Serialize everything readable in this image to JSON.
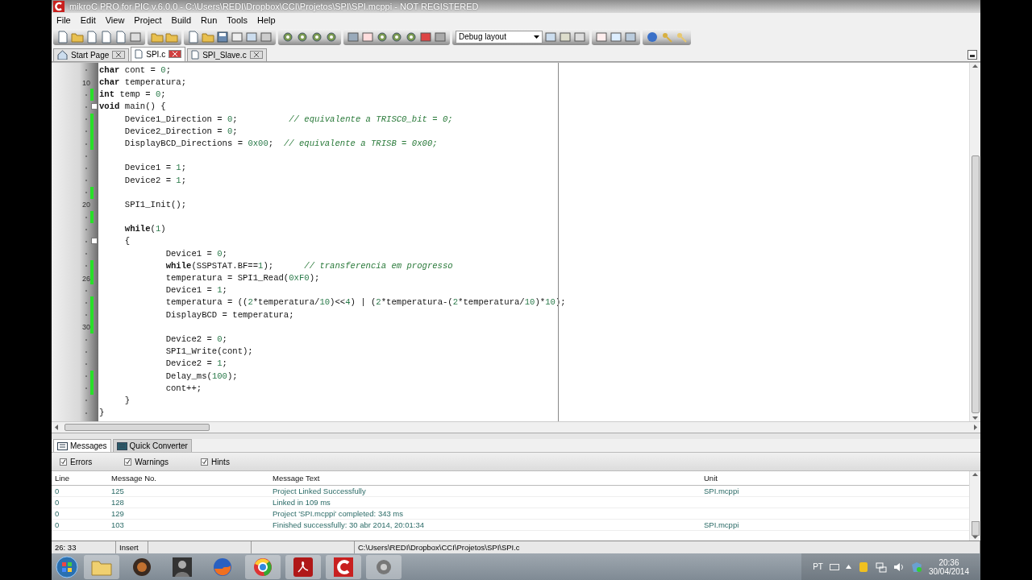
{
  "window": {
    "title": "mikroC PRO for PIC v.6.0.0 - C:\\Users\\REDI\\Dropbox\\CCI\\Projetos\\SPI\\SPI.mcppi - NOT REGISTERED"
  },
  "menu": [
    "File",
    "Edit",
    "View",
    "Project",
    "Build",
    "Run",
    "Tools",
    "Help"
  ],
  "toolbar": {
    "layout_dropdown": "Debug layout"
  },
  "tabs": [
    {
      "label": "Start Page",
      "selected": false
    },
    {
      "label": "SPI.c",
      "selected": true
    },
    {
      "label": "SPI_Slave.c",
      "selected": false
    }
  ],
  "editor": {
    "lines": [
      {
        "changed": false,
        "fold": false,
        "segs": [
          {
            "kind": "keyword",
            "text": "char"
          },
          {
            "kind": "plain",
            "text": " cont = "
          },
          {
            "kind": "number",
            "text": "0"
          },
          {
            "kind": "plain",
            "text": ";"
          }
        ]
      },
      {
        "number": "10",
        "changed": false,
        "fold": false,
        "segs": [
          {
            "kind": "keyword",
            "text": "char"
          },
          {
            "kind": "plain",
            "text": " temperatura;"
          }
        ]
      },
      {
        "changed": true,
        "fold": false,
        "segs": [
          {
            "kind": "keyword",
            "text": "int"
          },
          {
            "kind": "plain",
            "text": " temp = "
          },
          {
            "kind": "number",
            "text": "0"
          },
          {
            "kind": "plain",
            "text": ";"
          }
        ]
      },
      {
        "changed": false,
        "fold": true,
        "segs": [
          {
            "kind": "keyword",
            "text": "void"
          },
          {
            "kind": "plain",
            "text": " main() {"
          }
        ]
      },
      {
        "changed": true,
        "fold": false,
        "segs": [
          {
            "kind": "plain",
            "text": "     Device1_Direction = "
          },
          {
            "kind": "number",
            "text": "0"
          },
          {
            "kind": "plain",
            "text": ";          "
          },
          {
            "kind": "comment",
            "text": "// equivalente a TRISC0_bit = 0;"
          }
        ]
      },
      {
        "changed": true,
        "fold": false,
        "segs": [
          {
            "kind": "plain",
            "text": "     Device2_Direction = "
          },
          {
            "kind": "number",
            "text": "0"
          },
          {
            "kind": "plain",
            "text": ";"
          }
        ]
      },
      {
        "changed": true,
        "fold": false,
        "segs": [
          {
            "kind": "plain",
            "text": "     DisplayBCD_Directions = "
          },
          {
            "kind": "number",
            "text": "0x00"
          },
          {
            "kind": "plain",
            "text": ";  "
          },
          {
            "kind": "comment",
            "text": "// equivalente a TRISB = 0x00;"
          }
        ]
      },
      {
        "changed": false,
        "fold": false
      },
      {
        "changed": false,
        "fold": false,
        "segs": [
          {
            "kind": "plain",
            "text": "     Device1 = "
          },
          {
            "kind": "number",
            "text": "1"
          },
          {
            "kind": "plain",
            "text": ";"
          }
        ]
      },
      {
        "changed": false,
        "fold": false,
        "segs": [
          {
            "kind": "plain",
            "text": "     Device2 = "
          },
          {
            "kind": "number",
            "text": "1"
          },
          {
            "kind": "plain",
            "text": ";"
          }
        ]
      },
      {
        "changed": true,
        "fold": false
      },
      {
        "number": "20",
        "changed": false,
        "fold": false,
        "segs": [
          {
            "kind": "plain",
            "text": "     SPI1_Init();"
          }
        ]
      },
      {
        "changed": true,
        "fold": false
      },
      {
        "changed": false,
        "fold": false,
        "segs": [
          {
            "kind": "keyword",
            "text": "     while"
          },
          {
            "kind": "plain",
            "text": "("
          },
          {
            "kind": "number",
            "text": "1"
          },
          {
            "kind": "plain",
            "text": ")"
          }
        ]
      },
      {
        "changed": false,
        "fold": true,
        "segs": [
          {
            "kind": "plain",
            "text": "     {"
          }
        ]
      },
      {
        "changed": false,
        "fold": false,
        "segs": [
          {
            "kind": "plain",
            "text": "             Device1 = "
          },
          {
            "kind": "number",
            "text": "0"
          },
          {
            "kind": "plain",
            "text": ";"
          }
        ]
      },
      {
        "changed": true,
        "fold": false,
        "segs": [
          {
            "kind": "keyword",
            "text": "             while"
          },
          {
            "kind": "plain",
            "text": "(SSPSTAT.BF=="
          },
          {
            "kind": "number",
            "text": "1"
          },
          {
            "kind": "plain",
            "text": ");      "
          },
          {
            "kind": "comment",
            "text": "// transferencia em progresso"
          }
        ]
      },
      {
        "number": "26",
        "changed": true,
        "fold": false,
        "segs": [
          {
            "kind": "plain",
            "text": "             temperatura = SPI1_Read("
          },
          {
            "kind": "number",
            "text": "0xF0"
          },
          {
            "kind": "plain",
            "text": ");"
          }
        ]
      },
      {
        "changed": false,
        "fold": false,
        "segs": [
          {
            "kind": "plain",
            "text": "             Device1 = "
          },
          {
            "kind": "number",
            "text": "1"
          },
          {
            "kind": "plain",
            "text": ";"
          }
        ]
      },
      {
        "changed": true,
        "fold": false,
        "segs": [
          {
            "kind": "plain",
            "text": "             temperatura = (("
          },
          {
            "kind": "number",
            "text": "2"
          },
          {
            "kind": "plain",
            "text": "*temperatura/"
          },
          {
            "kind": "number",
            "text": "10"
          },
          {
            "kind": "plain",
            "text": ")<<"
          },
          {
            "kind": "number",
            "text": "4"
          },
          {
            "kind": "plain",
            "text": ") | ("
          },
          {
            "kind": "number",
            "text": "2"
          },
          {
            "kind": "plain",
            "text": "*temperatura-("
          },
          {
            "kind": "number",
            "text": "2"
          },
          {
            "kind": "plain",
            "text": "*temperatura/"
          },
          {
            "kind": "number",
            "text": "10"
          },
          {
            "kind": "plain",
            "text": ")*"
          },
          {
            "kind": "number",
            "text": "10"
          },
          {
            "kind": "plain",
            "text": ");"
          }
        ]
      },
      {
        "changed": true,
        "fold": false,
        "segs": [
          {
            "kind": "plain",
            "text": "             DisplayBCD = temperatura;"
          }
        ]
      },
      {
        "number": "30",
        "changed": true,
        "fold": false
      },
      {
        "changed": false,
        "fold": false,
        "segs": [
          {
            "kind": "plain",
            "text": "             Device2 = "
          },
          {
            "kind": "number",
            "text": "0"
          },
          {
            "kind": "plain",
            "text": ";"
          }
        ]
      },
      {
        "changed": false,
        "fold": false,
        "segs": [
          {
            "kind": "plain",
            "text": "             SPI1_Write(cont);"
          }
        ]
      },
      {
        "changed": false,
        "fold": false,
        "segs": [
          {
            "kind": "plain",
            "text": "             Device2 = "
          },
          {
            "kind": "number",
            "text": "1"
          },
          {
            "kind": "plain",
            "text": ";"
          }
        ]
      },
      {
        "changed": true,
        "fold": false,
        "segs": [
          {
            "kind": "plain",
            "text": "             Delay_ms("
          },
          {
            "kind": "number",
            "text": "100"
          },
          {
            "kind": "plain",
            "text": ");"
          }
        ]
      },
      {
        "changed": true,
        "fold": false,
        "segs": [
          {
            "kind": "plain",
            "text": "             cont++;"
          }
        ]
      },
      {
        "changed": false,
        "fold": false,
        "segs": [
          {
            "kind": "plain",
            "text": "     }"
          }
        ]
      },
      {
        "changed": false,
        "fold": false,
        "segs": [
          {
            "kind": "plain",
            "text": "}"
          }
        ]
      }
    ]
  },
  "bottom_tabs": [
    {
      "label": "Messages",
      "selected": true
    },
    {
      "label": "Quick Converter",
      "selected": false
    }
  ],
  "filters": [
    {
      "label": "Errors",
      "checked": true
    },
    {
      "label": "Warnings",
      "checked": true
    },
    {
      "label": "Hints",
      "checked": true
    }
  ],
  "messages": {
    "columns": [
      "Line",
      "Message No.",
      "Message Text",
      "Unit"
    ],
    "rows": [
      {
        "line": "0",
        "number": "125",
        "text": "Project Linked Successfully",
        "unit": "SPI.mcppi"
      },
      {
        "line": "0",
        "number": "128",
        "text": "Linked in 109 ms"
      },
      {
        "line": "0",
        "number": "129",
        "text": "Project 'SPI.mcppi' completed: 343 ms"
      },
      {
        "line": "0",
        "number": "103",
        "text": "Finished successfully: 30 abr 2014, 20:01:34",
        "unit": "SPI.mcppi"
      }
    ]
  },
  "status_bar": {
    "position": "26: 33",
    "mode": "Insert",
    "path": "C:\\Users\\REDI\\Dropbox\\CCI\\Projetos\\SPI\\SPI.c"
  },
  "taskbar": {
    "language": "PT",
    "time": "20:36",
    "date": "30/04/2014"
  }
}
